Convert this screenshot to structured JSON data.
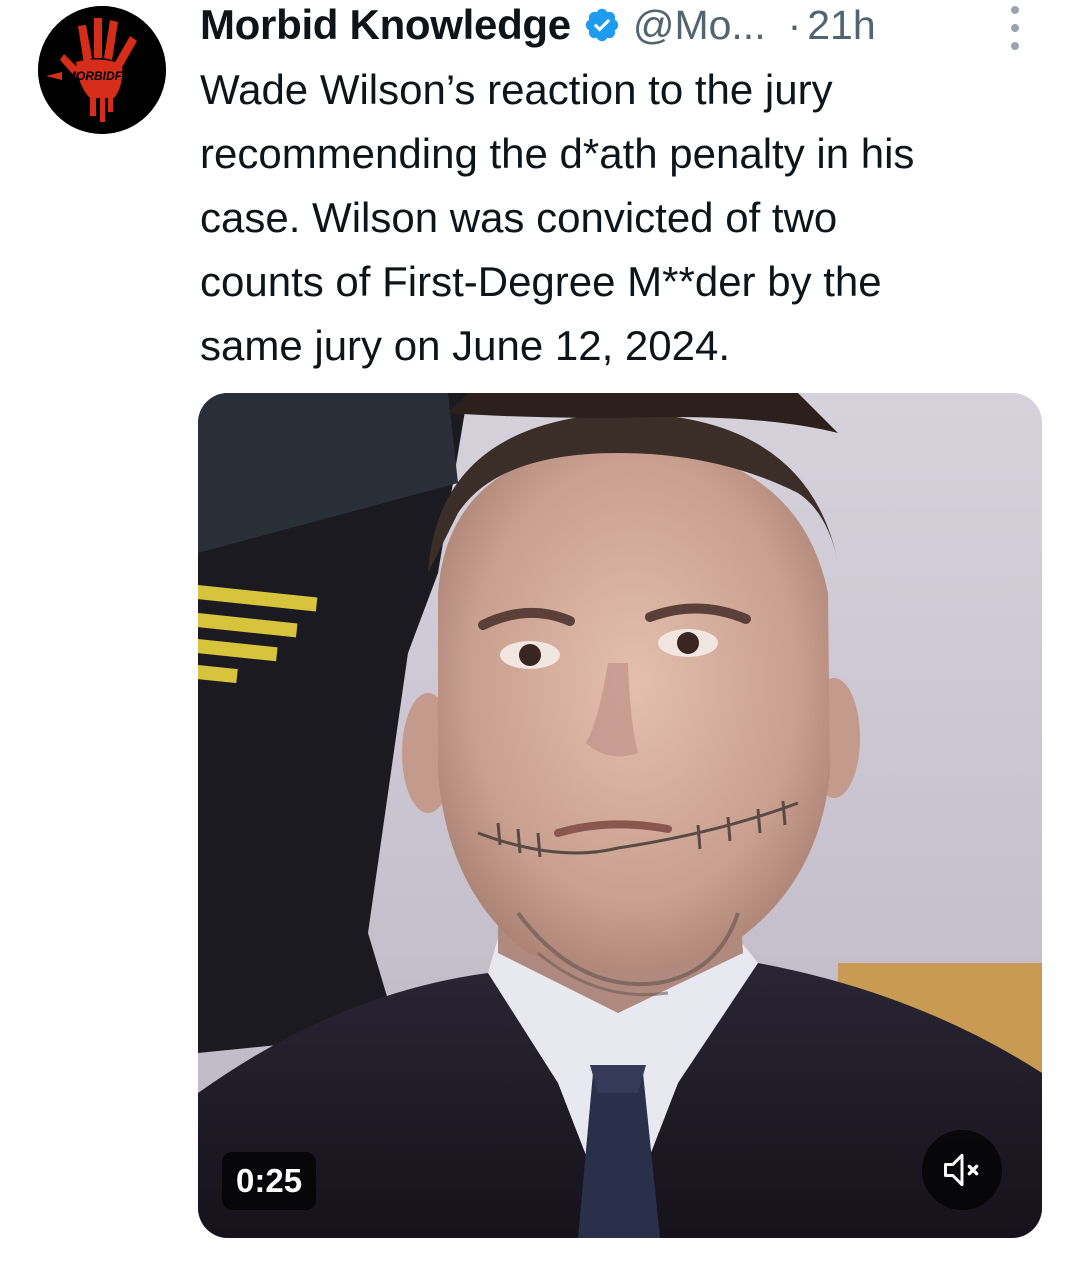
{
  "author": {
    "display_name": "Morbid Knowledge",
    "handle": "@Mo...",
    "separator": "·",
    "timestamp": "21h",
    "verified": true,
    "avatar_text": "MORBIDFUL"
  },
  "tweet": {
    "text": "Wade Wilson’s reaction to the jury\nrecommending the d*ath penalty in his\ncase. Wilson was convicted of two\ncounts of First-Degree M**der by the\nsame jury on June 12, 2024."
  },
  "media": {
    "type": "video",
    "duration": "0:25",
    "muted": true
  },
  "icons": {
    "verified": "verified-badge-icon",
    "more": "more-options-icon",
    "mute": "volume-muted-icon"
  },
  "colors": {
    "text_primary": "#0f1419",
    "text_secondary": "#536471",
    "verified_blue": "#1d9bf0",
    "avatar_red": "#d62c1a"
  }
}
